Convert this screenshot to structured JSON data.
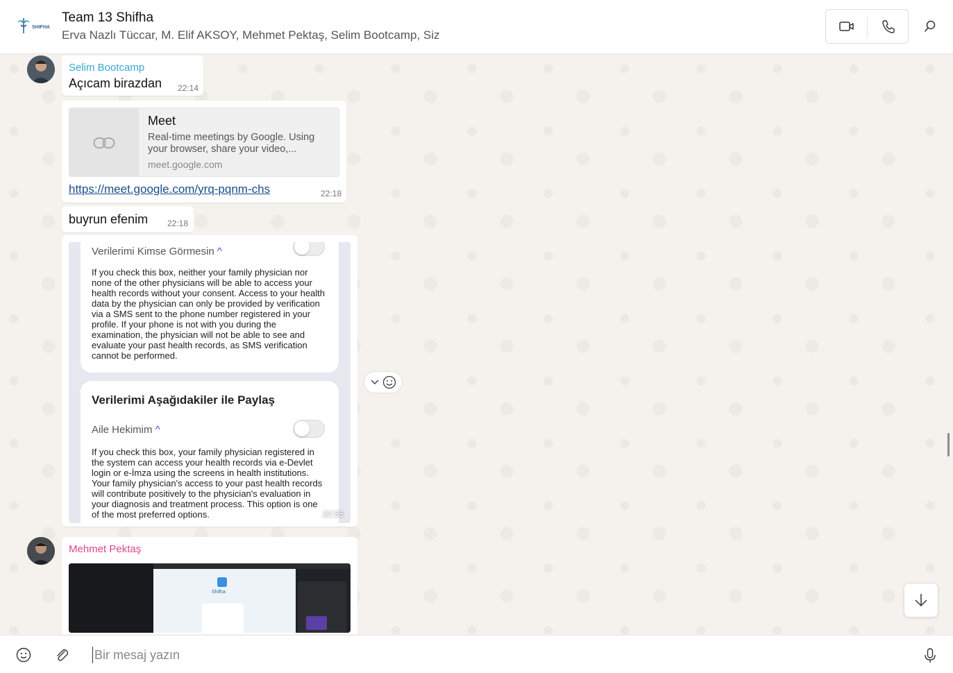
{
  "header": {
    "logo_text": "SHIFHA",
    "title": "Team 13 Shifha",
    "members": "Erva Nazlı Tüccar, M. Elif AKSOY, Mehmet Pektaş, Selim Bootcamp, Siz",
    "icons": [
      "video-call-icon",
      "voice-call-icon",
      "search-icon"
    ]
  },
  "messages": {
    "m1": {
      "sender": "Selim Bootcamp",
      "sender_color": "#35a7d6",
      "text": "Açıcam birazdan",
      "time": "22:14"
    },
    "m2": {
      "preview_title": "Meet",
      "preview_desc": "Real-time meetings by Google. Using your browser, share your video,...",
      "preview_domain": "meet.google.com",
      "link": "https://meet.google.com/yrq-pqnm-chs",
      "time": "22:18"
    },
    "m3": {
      "text": "buyrun efenim",
      "time": "22:18"
    },
    "m4": {
      "card1_label": "Verilerimi Kimse Görmesin",
      "card1_body": "If you check this box, neither your family physician nor none of the other physicians will be able to access your health records without your consent. Access to your health data by the physician can only be provided by verification via a SMS sent to the phone number registered in your profile. If your phone is not with you during the examination, the physician will not be able to see and evaluate your past health records, as SMS verification cannot be performed.",
      "card2_heading": "Verilerimi Aşağıdakiler ile Paylaş",
      "card2_label": "Aile Hekimim",
      "card2_body": "If you check this box, your family physician registered in the system can access your health records via e-Devlet login or e-İmza using the screens in health institutions. Your family physician's access to your past health records will contribute positively to the physician's evaluation in your diagnosis and treatment process. This option is one of the most preferred options.",
      "time": "22:55"
    },
    "m5": {
      "sender": "Mehmet Pektaş",
      "sender_color": "#d9468c",
      "preview_app_name": "Shifha"
    }
  },
  "composer": {
    "placeholder": "Bir mesaj yazın",
    "icons": [
      "emoji-icon",
      "attach-icon",
      "mic-icon"
    ]
  }
}
